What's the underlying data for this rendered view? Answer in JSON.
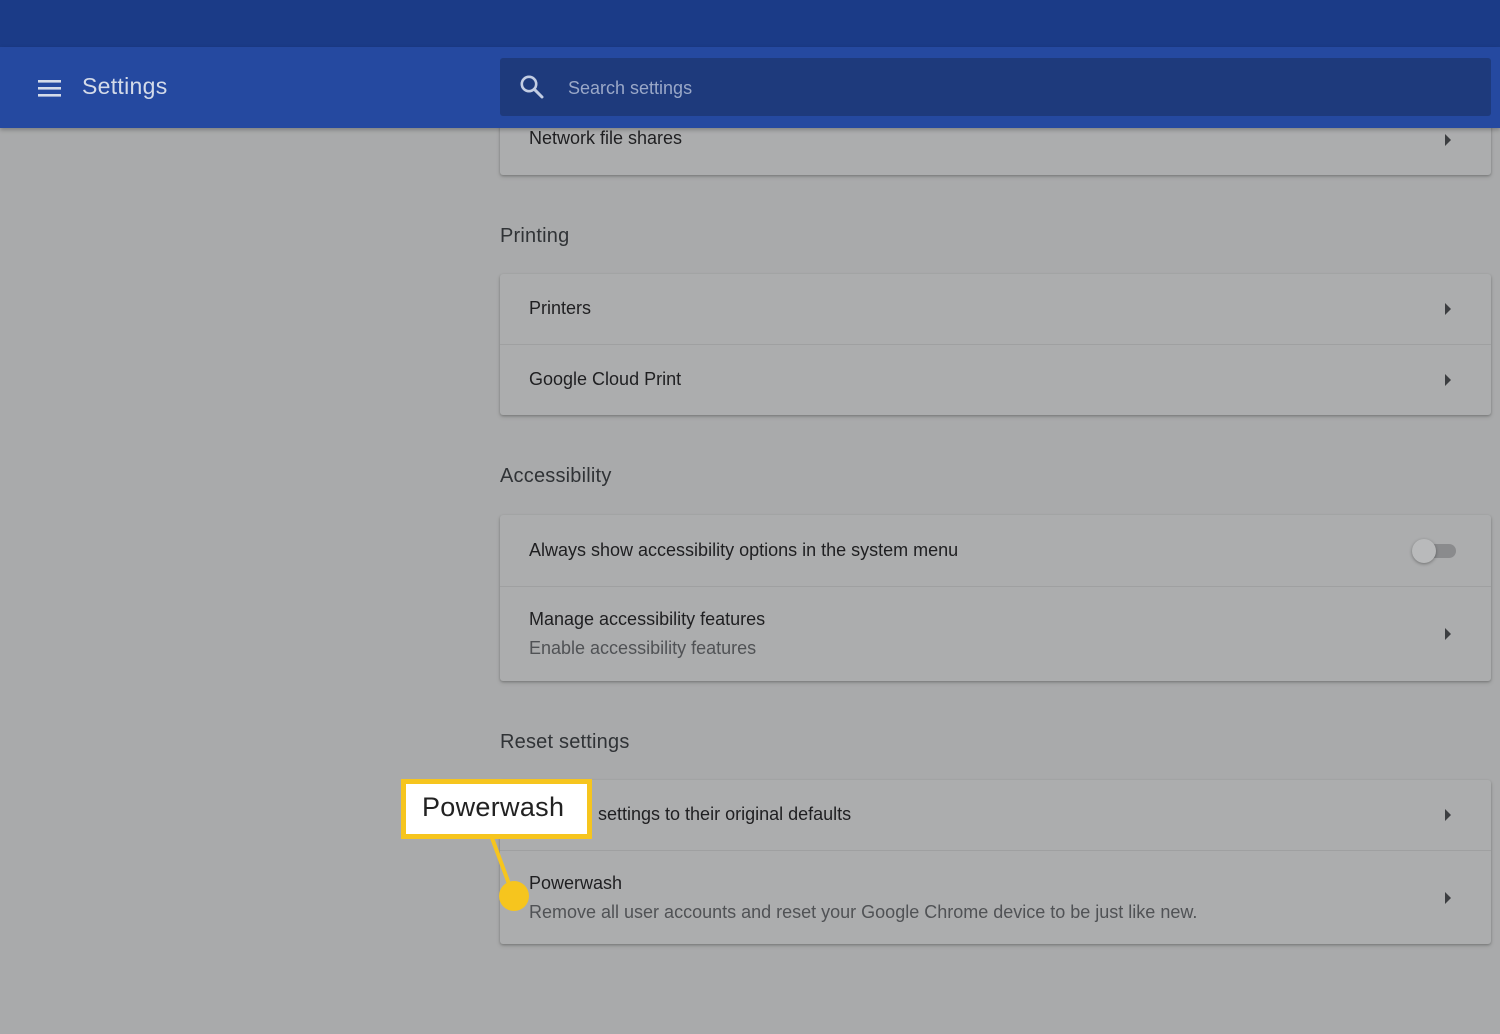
{
  "header": {
    "title": "Settings",
    "menu_icon": "hamburger-menu-icon",
    "search": {
      "placeholder": "Search settings",
      "value": "",
      "icon": "search-icon"
    }
  },
  "sections": {
    "network": {
      "rows": [
        {
          "label": "Network file shares"
        }
      ]
    },
    "printing": {
      "title": "Printing",
      "rows": [
        {
          "label": "Printers"
        },
        {
          "label": "Google Cloud Print"
        }
      ]
    },
    "accessibility": {
      "title": "Accessibility",
      "rows": [
        {
          "label": "Always show accessibility options in the system menu",
          "toggle_on": false
        },
        {
          "label": "Manage accessibility features",
          "sublabel": "Enable accessibility features"
        }
      ]
    },
    "reset": {
      "title": "Reset settings",
      "rows": [
        {
          "label": "settings to their original defaults"
        },
        {
          "label": "Powerwash",
          "sublabel": "Remove all user accounts and reset your Google Chrome device to be just like new."
        }
      ]
    }
  },
  "callout": {
    "label": "Powerwash"
  },
  "colors": {
    "top_strip": "#1b3b87",
    "appbar": "#2549a0",
    "search_bg": "#1e3a7c",
    "page_bg": "#a9aaab",
    "callout_accent": "#f6c51e"
  }
}
